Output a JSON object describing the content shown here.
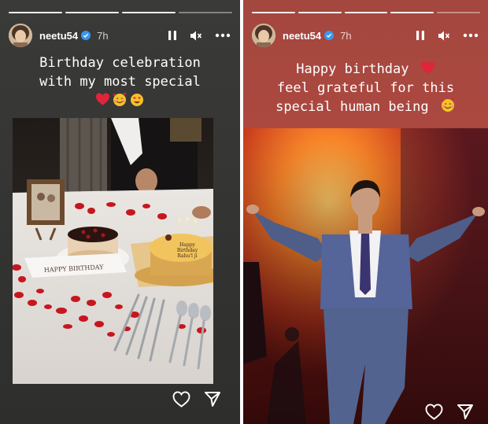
{
  "stories": [
    {
      "username": "neetu54",
      "time": "7h",
      "progress": {
        "segments": 4,
        "completed": 3
      },
      "caption": [
        "Birthday celebration",
        "with my most special"
      ],
      "caption_emojis": [
        "heart-emoji",
        "smiling-face-with-hearts-emoji",
        "heart-eyes-emoji"
      ],
      "photo_text": {
        "plate": "HAPPY BIRTHDAY",
        "cake": [
          "Happy",
          "Birthday",
          "Rahu'l ji"
        ]
      }
    },
    {
      "username": "neetu54",
      "time": "7h",
      "progress": {
        "segments": 5,
        "completed": 4
      },
      "caption": [
        "Happy birthday",
        "feel grateful for this",
        "special human being"
      ],
      "caption_emojis": [
        "heart-emoji",
        "smiling-face-with-hearts-emoji"
      ]
    }
  ],
  "icons": [
    "pause-icon",
    "mute-icon",
    "more-icon",
    "verified-icon",
    "heart-icon",
    "send-icon"
  ],
  "colors": {
    "left_background": "#333331",
    "right_background": "#a8463d",
    "heart": "#e0243a",
    "verified": "#3897f0"
  }
}
